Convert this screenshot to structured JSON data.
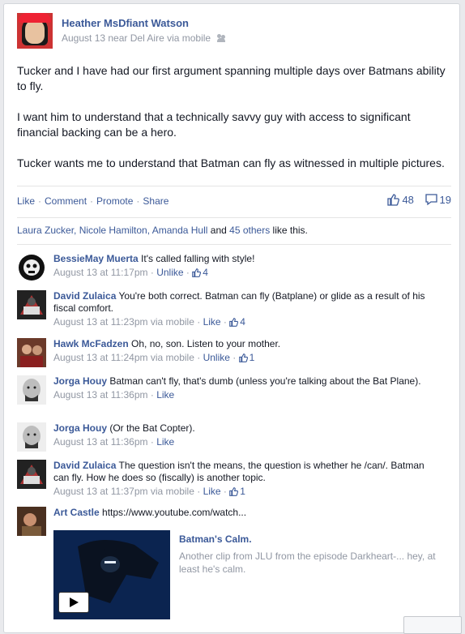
{
  "post": {
    "author": "Heather MsDfiant Watson",
    "meta": "August 13 near Del Aire via mobile",
    "paragraphs": [
      "Tucker and I have had our first argument spanning multiple days over Batmans ability to fly.",
      "I want him to understand that a technically savvy guy with access to significant financial backing can be a hero.",
      "Tucker wants me to understand that Batman can fly as witnessed in multiple pictures."
    ],
    "actions": {
      "like": "Like",
      "comment": "Comment",
      "promote": "Promote",
      "share": "Share",
      "sep": "·"
    },
    "like_count": "48",
    "comment_count": "19",
    "likers": {
      "names": "Laura Zucker, Nicole Hamilton, Amanda Hull",
      "and": " and ",
      "others": "45 others",
      "suffix": " like this."
    }
  },
  "comments": [
    {
      "name": "BessieMay Muerta",
      "text": " It's called falling with style!",
      "time": "August 13 at 11:17pm",
      "action": "Unlike",
      "likes": "4"
    },
    {
      "name": "David Zulaica",
      "text": " You're both correct. Batman can fly (Batplane) or glide as a result of his fiscal comfort.",
      "time": "August 13 at 11:23pm via mobile",
      "action": "Like",
      "likes": "4"
    },
    {
      "name": "Hawk McFadzen",
      "text": " Oh, no, son. Listen to your mother.",
      "time": "August 13 at 11:24pm via mobile",
      "action": "Unlike",
      "likes": "1"
    },
    {
      "name": "Jorga Houy",
      "text": " Batman can't fly, that's dumb (unless you're talking about the Bat Plane).",
      "time": "August 13 at 11:36pm",
      "action": "Like",
      "likes": ""
    },
    {
      "name": "Jorga Houy",
      "text": " (Or the Bat Copter).",
      "time": "August 13 at 11:36pm",
      "action": "Like",
      "likes": ""
    },
    {
      "name": "David Zulaica",
      "text": " The question isn't the means, the question is whether he /can/. Batman can fly. How he does so (fiscally) is another topic.",
      "time": "August 13 at 11:37pm via mobile",
      "action": "Like",
      "likes": "1"
    },
    {
      "name": "Art Castle",
      "text": " https://www.youtube.com/watch...",
      "time": "",
      "action": "",
      "likes": ""
    }
  ],
  "link_preview": {
    "title": "Batman's Calm.",
    "description": "Another clip from JLU from the episode Darkheart-... hey, at least he's calm."
  },
  "colors": {
    "link": "#3b5998",
    "meta": "#9197a3",
    "background": "#e9eaed"
  }
}
